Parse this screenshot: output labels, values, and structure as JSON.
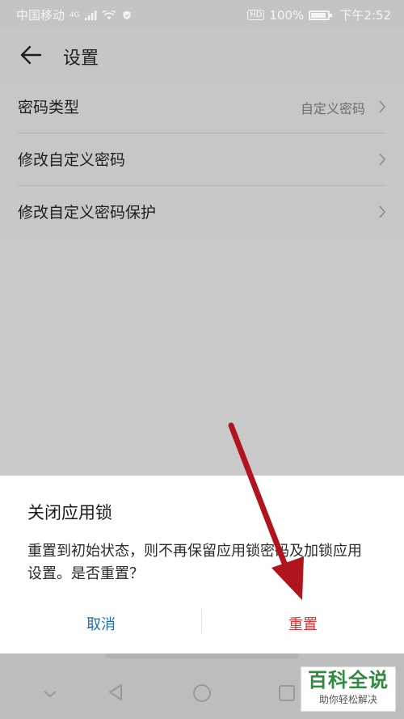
{
  "status_bar": {
    "carrier": "中国移动",
    "network": "4G",
    "battery_percent": "100%",
    "battery_level": 1.0,
    "time": "下午2:52",
    "hd_label": "HD"
  },
  "app_bar": {
    "title": "设置",
    "back_icon": "arrow-left-icon"
  },
  "settings": {
    "items": [
      {
        "label": "密码类型",
        "value": "自定义密码"
      },
      {
        "label": "修改自定义密码",
        "value": ""
      },
      {
        "label": "修改自定义密码保护",
        "value": ""
      }
    ]
  },
  "dialog": {
    "title": "关闭应用锁",
    "message": "重置到初始状态，则不再保留应用锁密码及加锁应用设置。是否重置？",
    "cancel_label": "取消",
    "confirm_label": "重置",
    "cancel_color": "#1e6cb0",
    "confirm_color": "#d43a3a"
  },
  "nav_bar": {
    "icons": [
      "chevron-down-icon",
      "back-triangle-icon",
      "home-circle-icon",
      "recents-square-icon"
    ]
  },
  "watermark": {
    "brand": "百科全说",
    "slogan": "助你轻松解决"
  },
  "annotation": {
    "arrow_color": "#b0141c"
  }
}
